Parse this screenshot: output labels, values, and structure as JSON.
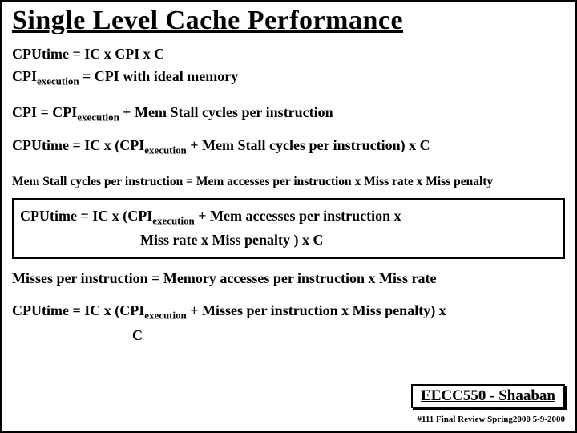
{
  "title": "Single Level Cache Performance",
  "lines": {
    "l1": "CPUtime =   IC  x  CPI  x  C",
    "l2a": "CPI",
    "l2b": "execution",
    "l2c": "  =   CPI with ideal memory",
    "l3a": "CPI =    CPI",
    "l3b": "execution",
    "l3c": " +   Mem Stall cycles per instruction",
    "l4a": "CPUtime  =  IC x   (CPI",
    "l4b": "execution",
    "l4c": "  +  Mem Stall  cycles per instruction)    x   C",
    "l5": "Mem Stall cycles per instruction =  Mem accesses per instruction  x  Miss rate  x  Miss penalty",
    "l6a": "CPUtime  =  IC x  (CPI",
    "l6b": "execution",
    "l6c": " +  Mem accesses per instruction  x",
    "l6d": " Miss rate x  Miss penalty )  x   C",
    "l7": "Misses per instruction =  Memory accesses per instruction  x  Miss rate",
    "l8a": "CPUtime =  IC x (CPI",
    "l8b": "execution",
    "l8c": " + Misses per instruction  x  Miss penalty) x",
    "l8d": "C"
  },
  "footer": {
    "course": "EECC550 - Shaaban",
    "meta": "#111   Final Review   Spring2000   5-9-2000"
  }
}
